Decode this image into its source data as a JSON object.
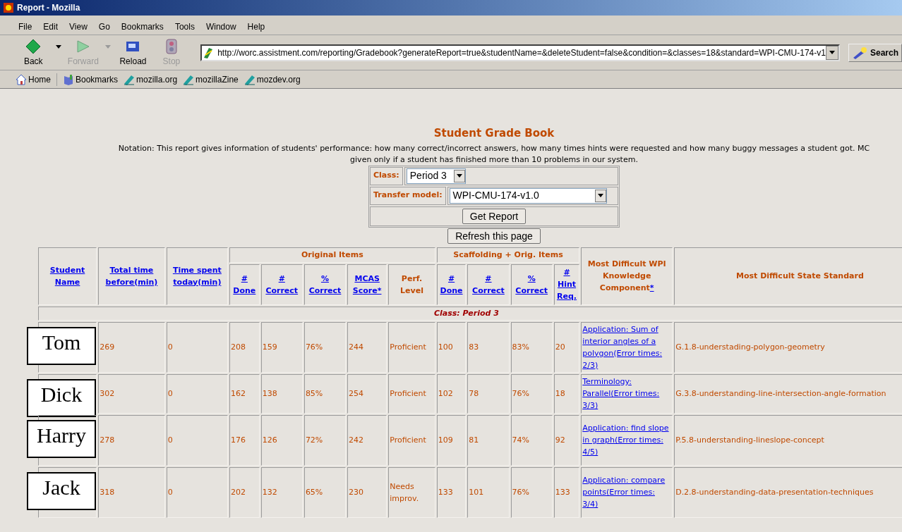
{
  "window": {
    "title": "Report - Mozilla"
  },
  "menu": [
    "File",
    "Edit",
    "View",
    "Go",
    "Bookmarks",
    "Tools",
    "Window",
    "Help"
  ],
  "toolbar": [
    {
      "label": "Back",
      "kind": "back",
      "disabled": false,
      "dropdown": true
    },
    {
      "label": "Forward",
      "kind": "forward",
      "disabled": true,
      "dropdown": true
    },
    {
      "label": "Reload",
      "kind": "reload",
      "disabled": false,
      "dropdown": false
    },
    {
      "label": "Stop",
      "kind": "stop",
      "disabled": true,
      "dropdown": false
    }
  ],
  "address": {
    "value": "http://worc.assistment.com/reporting/Gradebook?generateReport=true&studentName=&deleteStudent=false&condition=&classes=18&standard=WPI-CMU-174-v1"
  },
  "search_button": "Search",
  "personal_toolbar": [
    {
      "label": "Home",
      "kind": "home"
    },
    {
      "label": "Bookmarks",
      "kind": "bookmarks"
    },
    {
      "label": "mozilla.org",
      "kind": "link"
    },
    {
      "label": "mozillaZine",
      "kind": "link"
    },
    {
      "label": "mozdev.org",
      "kind": "link"
    }
  ],
  "report": {
    "title": "Student Grade Book",
    "notation": [
      "Notation: This report gives information of students' performance: how many correct/incorrect answers, how many times hints were requested and how many buggy messages a student got. MC",
      "given only if a student has finished more than 10 problems in our system."
    ],
    "form": {
      "class_label": "Class:",
      "class_value": "Period 3",
      "model_label": "Transfer model:",
      "model_value": "WPI-CMU-174-v1.0",
      "submit": "Get Report"
    },
    "refresh": "Refresh this page"
  },
  "table": {
    "header": [
      {
        "label": "Student Name",
        "kind": "link"
      },
      {
        "label": "Total time before(min)",
        "kind": "link"
      },
      {
        "label": "Time spent today(min)",
        "kind": "link"
      },
      {
        "label": "Original Items",
        "kind": "group",
        "columns": [
          {
            "label": "# Done",
            "link": true
          },
          {
            "label": "# Correct",
            "link": true
          },
          {
            "label": "% Correct",
            "link": true
          },
          {
            "label": "MCAS Score*",
            "link": true
          },
          {
            "label": "Perf. Level",
            "link": false
          }
        ]
      },
      {
        "label": "Scaffolding + Orig. Items",
        "kind": "group",
        "columns": [
          {
            "label": "# Done",
            "link": true
          },
          {
            "label": "# Correct",
            "link": true
          },
          {
            "label": "% Correct",
            "link": true
          },
          {
            "label": "# Hint Req.",
            "link": true
          }
        ]
      },
      {
        "label": "Most Difficult WPI Knowledge Component",
        "kind": "text",
        "footnote": "*"
      },
      {
        "label": "Most Difficult State Standard",
        "kind": "text"
      }
    ],
    "class_row": "Class: Period 3",
    "rows": [
      {
        "name": "Tom",
        "values": [
          "269",
          "0",
          "208",
          "159",
          "76%",
          "244",
          "Proficient",
          "100",
          "83",
          "83%",
          "20"
        ],
        "component": "Application: Sum of interior angles of a polygon(Error times: 2/3)",
        "standard": "G.1.8-understading-polygon-geometry"
      },
      {
        "name": "Dick",
        "values": [
          "302",
          "0",
          "162",
          "138",
          "85%",
          "254",
          "Proficient",
          "102",
          "78",
          "76%",
          "18"
        ],
        "component": "Terminology: Parallel(Error times: 3/3)",
        "standard": "G.3.8-understanding-line-intersection-angle-formation"
      },
      {
        "name": "Harry",
        "values": [
          "278",
          "0",
          "176",
          "126",
          "72%",
          "242",
          "Proficient",
          "109",
          "81",
          "74%",
          "92"
        ],
        "component": "Application: find slope in graph(Error times: 4/5)",
        "standard": "P.5.8-understanding-lineslope-concept"
      },
      {
        "name": "Jack",
        "values": [
          "318",
          "0",
          "202",
          "132",
          "65%",
          "230",
          "Needs improv.",
          "133",
          "101",
          "76%",
          "133"
        ],
        "component": "Application: compare points(Error times: 3/4)",
        "standard": "D.2.8-understanding-data-presentation-techniques"
      }
    ]
  }
}
